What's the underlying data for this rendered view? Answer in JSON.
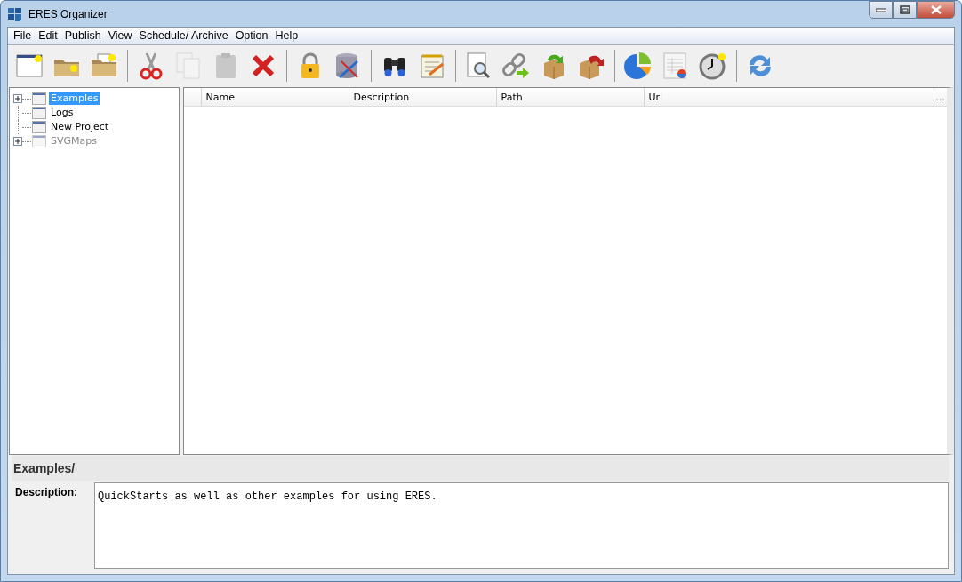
{
  "window": {
    "title": "ERES Organizer"
  },
  "menu": [
    "File",
    "Edit",
    "Publish",
    "View",
    "Schedule/ Archive",
    "Option",
    "Help"
  ],
  "toolbar": [
    {
      "kind": "new",
      "disabled": false
    },
    {
      "kind": "open",
      "disabled": false
    },
    {
      "kind": "openfile",
      "disabled": false
    },
    {
      "kind": "separator"
    },
    {
      "kind": "cut",
      "disabled": false
    },
    {
      "kind": "copy",
      "disabled": true
    },
    {
      "kind": "paste",
      "disabled": true
    },
    {
      "kind": "delete",
      "disabled": false
    },
    {
      "kind": "separator"
    },
    {
      "kind": "lock",
      "disabled": false
    },
    {
      "kind": "database",
      "disabled": false
    },
    {
      "kind": "separator"
    },
    {
      "kind": "find",
      "disabled": false
    },
    {
      "kind": "edit",
      "disabled": false
    },
    {
      "kind": "separator"
    },
    {
      "kind": "preview",
      "disabled": false
    },
    {
      "kind": "link",
      "disabled": false
    },
    {
      "kind": "import",
      "disabled": false
    },
    {
      "kind": "export",
      "disabled": false
    },
    {
      "kind": "separator"
    },
    {
      "kind": "chart",
      "disabled": false
    },
    {
      "kind": "report",
      "disabled": false
    },
    {
      "kind": "schedule",
      "disabled": false
    },
    {
      "kind": "separator"
    },
    {
      "kind": "refresh",
      "disabled": false
    }
  ],
  "tree": [
    {
      "label": "Examples",
      "selected": true,
      "expandable": true,
      "disabled": false
    },
    {
      "label": "Logs",
      "selected": false,
      "expandable": false,
      "disabled": false
    },
    {
      "label": "New Project",
      "selected": false,
      "expandable": false,
      "disabled": false
    },
    {
      "label": "SVGMaps",
      "selected": false,
      "expandable": true,
      "disabled": true
    }
  ],
  "table": {
    "columns": [
      "Name",
      "Description",
      "Path",
      "Url"
    ],
    "more": "..."
  },
  "details": {
    "title": "Examples/",
    "description_label": "Description:",
    "description": "QuickStarts as well as other examples for using ERES."
  }
}
